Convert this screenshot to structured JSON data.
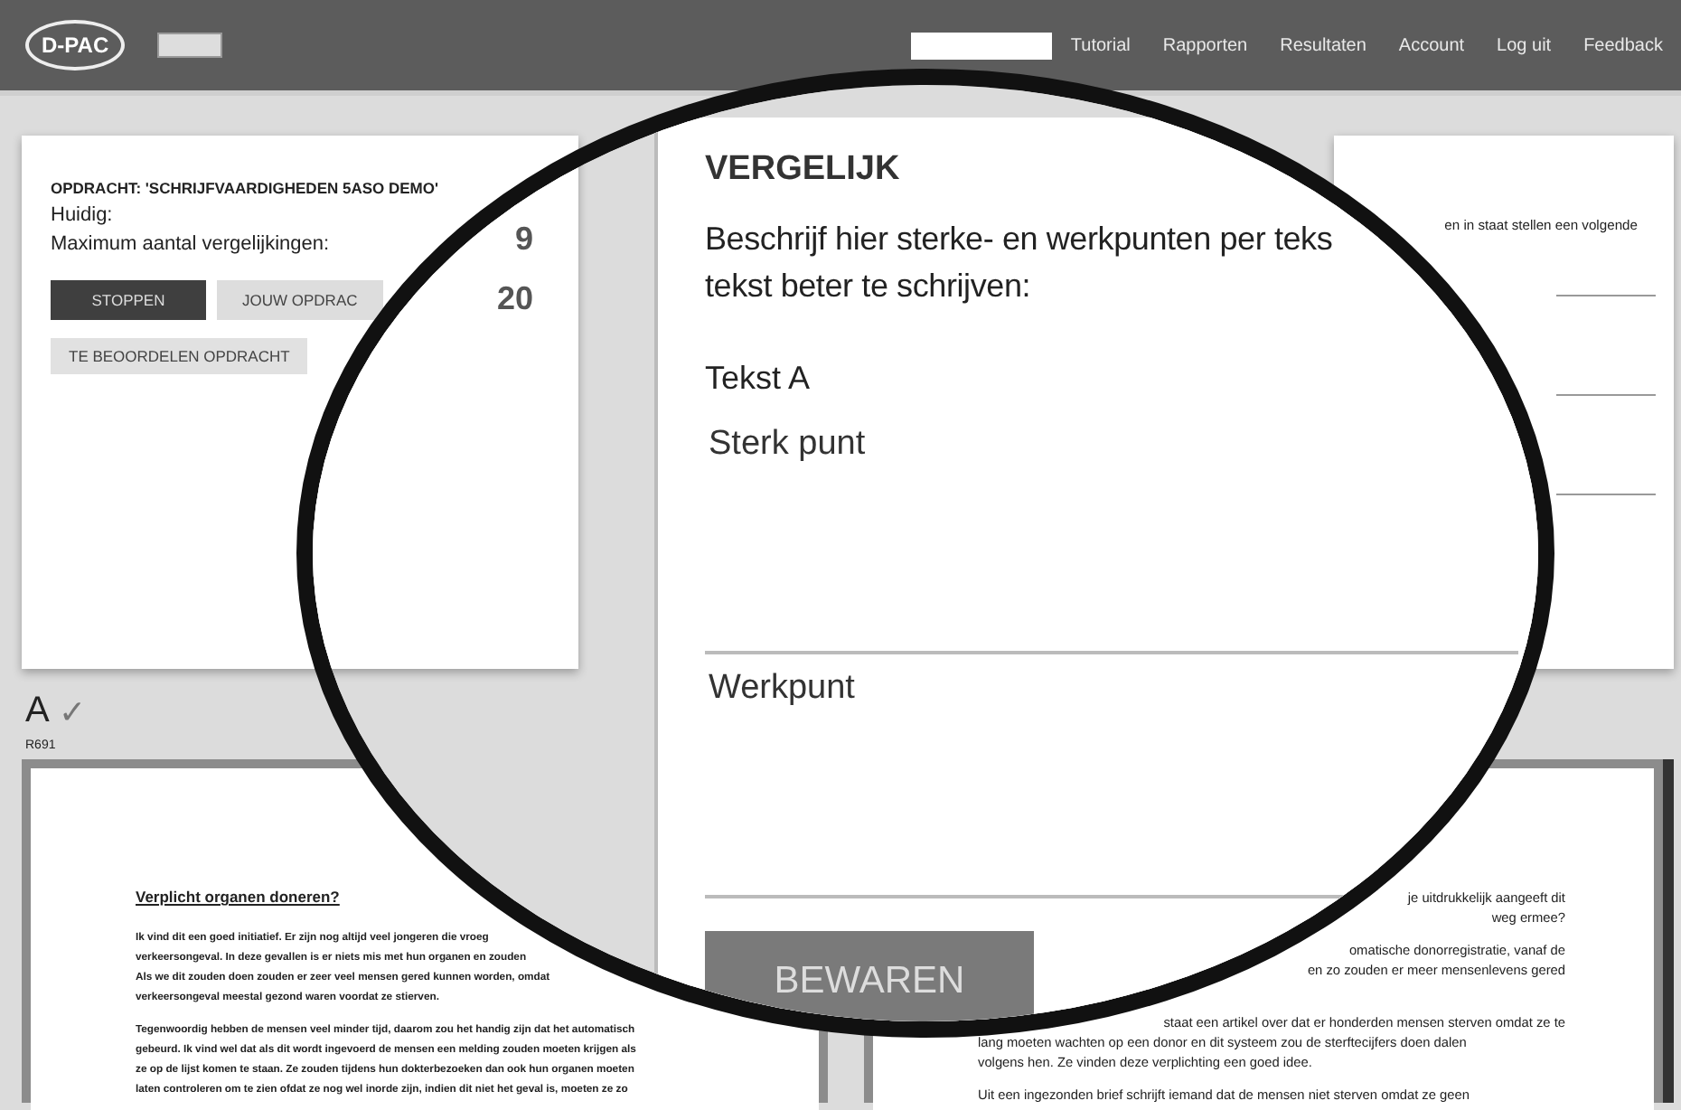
{
  "navbar": {
    "logo": "D-PAC",
    "items": [
      {
        "selected": true
      },
      {
        "label": "Tutorial",
        "selected": false
      },
      {
        "label": "Rapporten",
        "selected": false
      },
      {
        "label": "Resultaten",
        "selected": false
      },
      {
        "label": "Account",
        "selected": false
      },
      {
        "label": "Log uit",
        "selected": false
      },
      {
        "label": "Feedback",
        "selected": false
      }
    ]
  },
  "assignment_card": {
    "title": "OPDRACHT: 'SCHRIJFVAARDIGHEDEN 5ASO DEMO'",
    "current_label": "Huidig:",
    "max_label": "Maximum aantal vergelijkingen:",
    "buttons": [
      {
        "label": "STOPPEN",
        "selected": true
      },
      {
        "label": "JOUW OPDRAC",
        "selected": false
      }
    ],
    "review_button": "TE BEOORDELEN OPDRACHT"
  },
  "side_card": {
    "text": "en in staat stellen een volgende"
  },
  "text_a": {
    "label": "A",
    "check": "✓",
    "code": "R691"
  },
  "left_document": {
    "title": "Verplicht organen doneren?",
    "paragraphs": [
      [
        "Ik vind dit een goed initiatief. Er zijn nog altijd veel jongeren die vroeg",
        "verkeersongeval. In deze gevallen is er niets mis met hun organen en zouden",
        "Als we dit zouden doen zouden er zeer veel mensen gered kunnen worden, omdat",
        "verkeersongeval meestal gezond waren voordat ze stierven."
      ],
      [
        "Tegenwoordig hebben de mensen veel minder tijd, daarom zou het  handig zijn dat het automatisch",
        "gebeurd. Ik vind wel dat als dit wordt ingevoerd de mensen een melding zouden moeten krijgen als",
        "ze op de lijst komen te staan. Ze zouden tijdens hun dokterbezoeken dan ook hun organen moeten",
        "laten controleren om te zien ofdat ze nog wel inorde zijn, indien dit niet het geval is, moeten ze zo"
      ]
    ]
  },
  "right_document": {
    "paragraphs": [
      [
        {
          "text": "je uitdrukkelijk aangeeft dit",
          "kind": "partial"
        },
        {
          "text": "weg ermee?",
          "kind": "partial"
        }
      ],
      [
        {
          "text": "omatische donorregistratie, vanaf de",
          "kind": "partial"
        },
        {
          "text": "en zo zouden er meer mensenlevens gered",
          "kind": "partial"
        }
      ],
      [
        {
          "text": "staat een artikel over dat er honderden mensen sterven omdat ze te",
          "kind": "partial"
        },
        {
          "text": "lang moeten wachten op een donor en dit systeem zou de sterftecijfers doen dalen",
          "kind": "full"
        },
        {
          "text": "volgens hen. Ze vinden deze verplichting een goed idee.",
          "kind": "full"
        }
      ],
      [
        {
          "text": "Uit een ingezonden brief schrijft iemand dat de mensen niet sterven omdat ze geen",
          "kind": "full"
        }
      ]
    ]
  },
  "magnifier": {
    "current_value": "9",
    "max_value": "20",
    "heading": "VERGELIJK",
    "instruction": [
      "Beschrijf hier sterke- en werkpunten per teks",
      "tekst beter te schrijven:"
    ],
    "text_label": "Tekst A",
    "fields": [
      {
        "placeholder": "Sterk punt"
      },
      {
        "placeholder": "Werkpunt"
      }
    ],
    "save_button": "BEWAREN"
  }
}
